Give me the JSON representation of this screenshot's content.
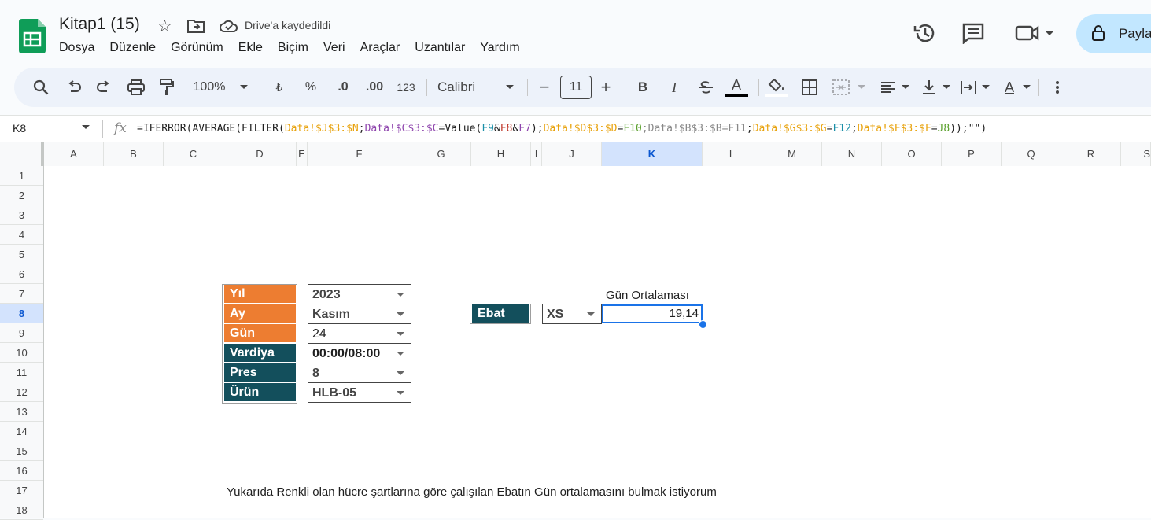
{
  "header": {
    "title": "Kitap1 (15)",
    "save_status": "Drive'a kaydedildi",
    "share_label": "Payla",
    "menu": [
      "Dosya",
      "Düzenle",
      "Görünüm",
      "Ekle",
      "Biçim",
      "Veri",
      "Araçlar",
      "Uzantılar",
      "Yardım"
    ]
  },
  "toolbar": {
    "zoom": "100%",
    "currency": "₺",
    "percent": "%",
    "dec_less": ".0",
    "dec_more": ".00",
    "num_format": "123",
    "font": "Calibri",
    "font_size": "11",
    "bold": "B",
    "italic": "I",
    "text_color": "A",
    "text_rotate": "A"
  },
  "formula_bar": {
    "name_box": "K8",
    "fx": "fx",
    "formula": [
      {
        "t": "=IFERROR(AVERAGE(FILTER(",
        "c": ""
      },
      {
        "t": "Data!$J$3:$N",
        "c": "fo"
      },
      {
        "t": ";",
        "c": ""
      },
      {
        "t": "Data!$C$3:$C",
        "c": "fp"
      },
      {
        "t": "=Value(",
        "c": ""
      },
      {
        "t": "F9",
        "c": "fb"
      },
      {
        "t": "&",
        "c": ""
      },
      {
        "t": "F8",
        "c": "fr"
      },
      {
        "t": "&",
        "c": ""
      },
      {
        "t": "F7",
        "c": "fp"
      },
      {
        "t": ");",
        "c": ""
      },
      {
        "t": "Data!$D$3:$D",
        "c": "fo"
      },
      {
        "t": "=",
        "c": ""
      },
      {
        "t": "F10",
        "c": "fg"
      },
      {
        "t": ";Data!$B$3:$B=",
        "c": "fgr"
      },
      {
        "t": "F11",
        "c": "fgr"
      },
      {
        "t": ";",
        "c": ""
      },
      {
        "t": "Data!$G$3:$G",
        "c": "fo"
      },
      {
        "t": "=",
        "c": ""
      },
      {
        "t": "F12",
        "c": "fb"
      },
      {
        "t": ";",
        "c": ""
      },
      {
        "t": "Data!$F$3:$F",
        "c": "fo"
      },
      {
        "t": "=",
        "c": ""
      },
      {
        "t": "J8",
        "c": "fg"
      },
      {
        "t": "));\"\")",
        "c": ""
      }
    ]
  },
  "grid": {
    "columns": [
      "A",
      "B",
      "C",
      "D",
      "E",
      "F",
      "G",
      "H",
      "I",
      "J",
      "K",
      "L",
      "M",
      "N",
      "O",
      "P",
      "Q",
      "R",
      "S"
    ],
    "rows": [
      "1",
      "2",
      "3",
      "4",
      "5",
      "6",
      "7",
      "8",
      "9",
      "10",
      "11",
      "12",
      "13",
      "14",
      "15",
      "16",
      "17",
      "18"
    ],
    "selected_column": "K",
    "selected_row": "8"
  },
  "filters": [
    {
      "label": "Yıl",
      "value": "2023",
      "color": "#ed7d31"
    },
    {
      "label": "Ay",
      "value": "Kasım",
      "color": "#ed7d31"
    },
    {
      "label": "Gün",
      "value": "24",
      "color": "#ed7d31"
    },
    {
      "label": "Vardiya",
      "value": "00:00/08:00",
      "color": "#134f5c"
    },
    {
      "label": "Pres",
      "value": "8",
      "color": "#134f5c"
    },
    {
      "label": "Ürün",
      "value": "HLB-05",
      "color": "#134f5c"
    }
  ],
  "ebat": {
    "label": "Ebat",
    "value": "XS"
  },
  "result": {
    "header": "Gün Ortalaması",
    "value": "19,14"
  },
  "caption": "Yukarıda Renkli olan hücre şartlarına göre çalışılan Ebatın Gün ortalamasını bulmak istiyorum"
}
